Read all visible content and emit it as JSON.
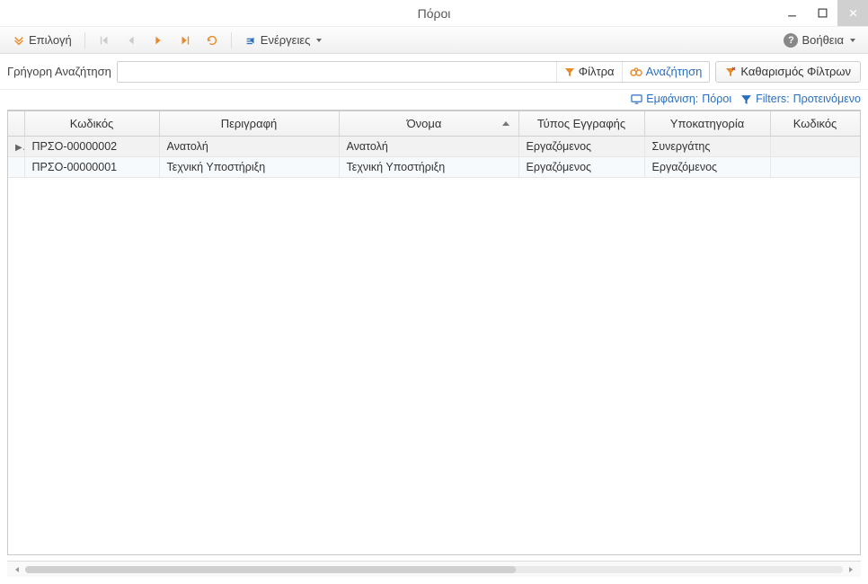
{
  "window": {
    "title": "Πόροι"
  },
  "toolbar": {
    "select_label": "Επιλογή",
    "actions_label": "Ενέργειες",
    "help_label": "Βοήθεια"
  },
  "search": {
    "quick_label": "Γρήγορη Αναζήτηση",
    "value": "",
    "filters_label": "Φίλτρα",
    "search_label": "Αναζήτηση",
    "clear_label": "Καθαρισμός Φίλτρων"
  },
  "links": {
    "view_label": "Εμφάνιση:",
    "view_value": "Πόροι",
    "filters_label": "Filters:",
    "filters_value": "Προτεινόμενο"
  },
  "grid": {
    "columns": [
      "Κωδικός",
      "Περιγραφή",
      "Όνομα",
      "Τύπος Εγγραφής",
      "Υποκατηγορία",
      "Κωδικός"
    ],
    "sort_column_index": 2,
    "sort_dir": "asc",
    "rows": [
      {
        "selected": true,
        "cells": [
          "ΠΡΣΟ-00000002",
          "Ανατολή",
          "Ανατολή",
          "Εργαζόμενος",
          "Συνεργάτης",
          ""
        ]
      },
      {
        "selected": false,
        "cells": [
          "ΠΡΣΟ-00000001",
          "Τεχνική Υποστήριξη",
          "Τεχνική Υποστήριξη",
          "Εργαζόμενος",
          "Εργαζόμενος",
          ""
        ]
      }
    ]
  }
}
